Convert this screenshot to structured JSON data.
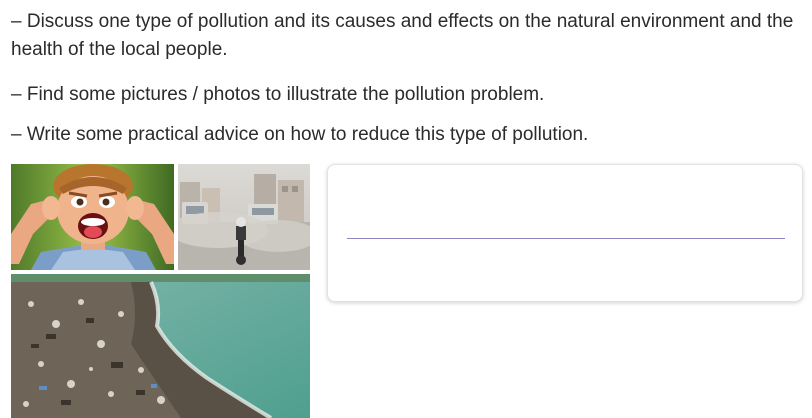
{
  "instructions": [
    "– Discuss one type of pollution and its causes and effects on the natural environment and the health of the local people.",
    "– Find some pictures / photos to illustrate the pollution problem.",
    "– Write some practical advice on how to reduce this type of pollution."
  ],
  "images": [
    {
      "icon": "noise-pollution-photo"
    },
    {
      "icon": "air-pollution-photo"
    },
    {
      "icon": "water-pollution-photo"
    }
  ],
  "colors": {
    "text": "#2b2b2b",
    "answer_line": "#8c86c0",
    "box_border": "#e2e2e2"
  }
}
